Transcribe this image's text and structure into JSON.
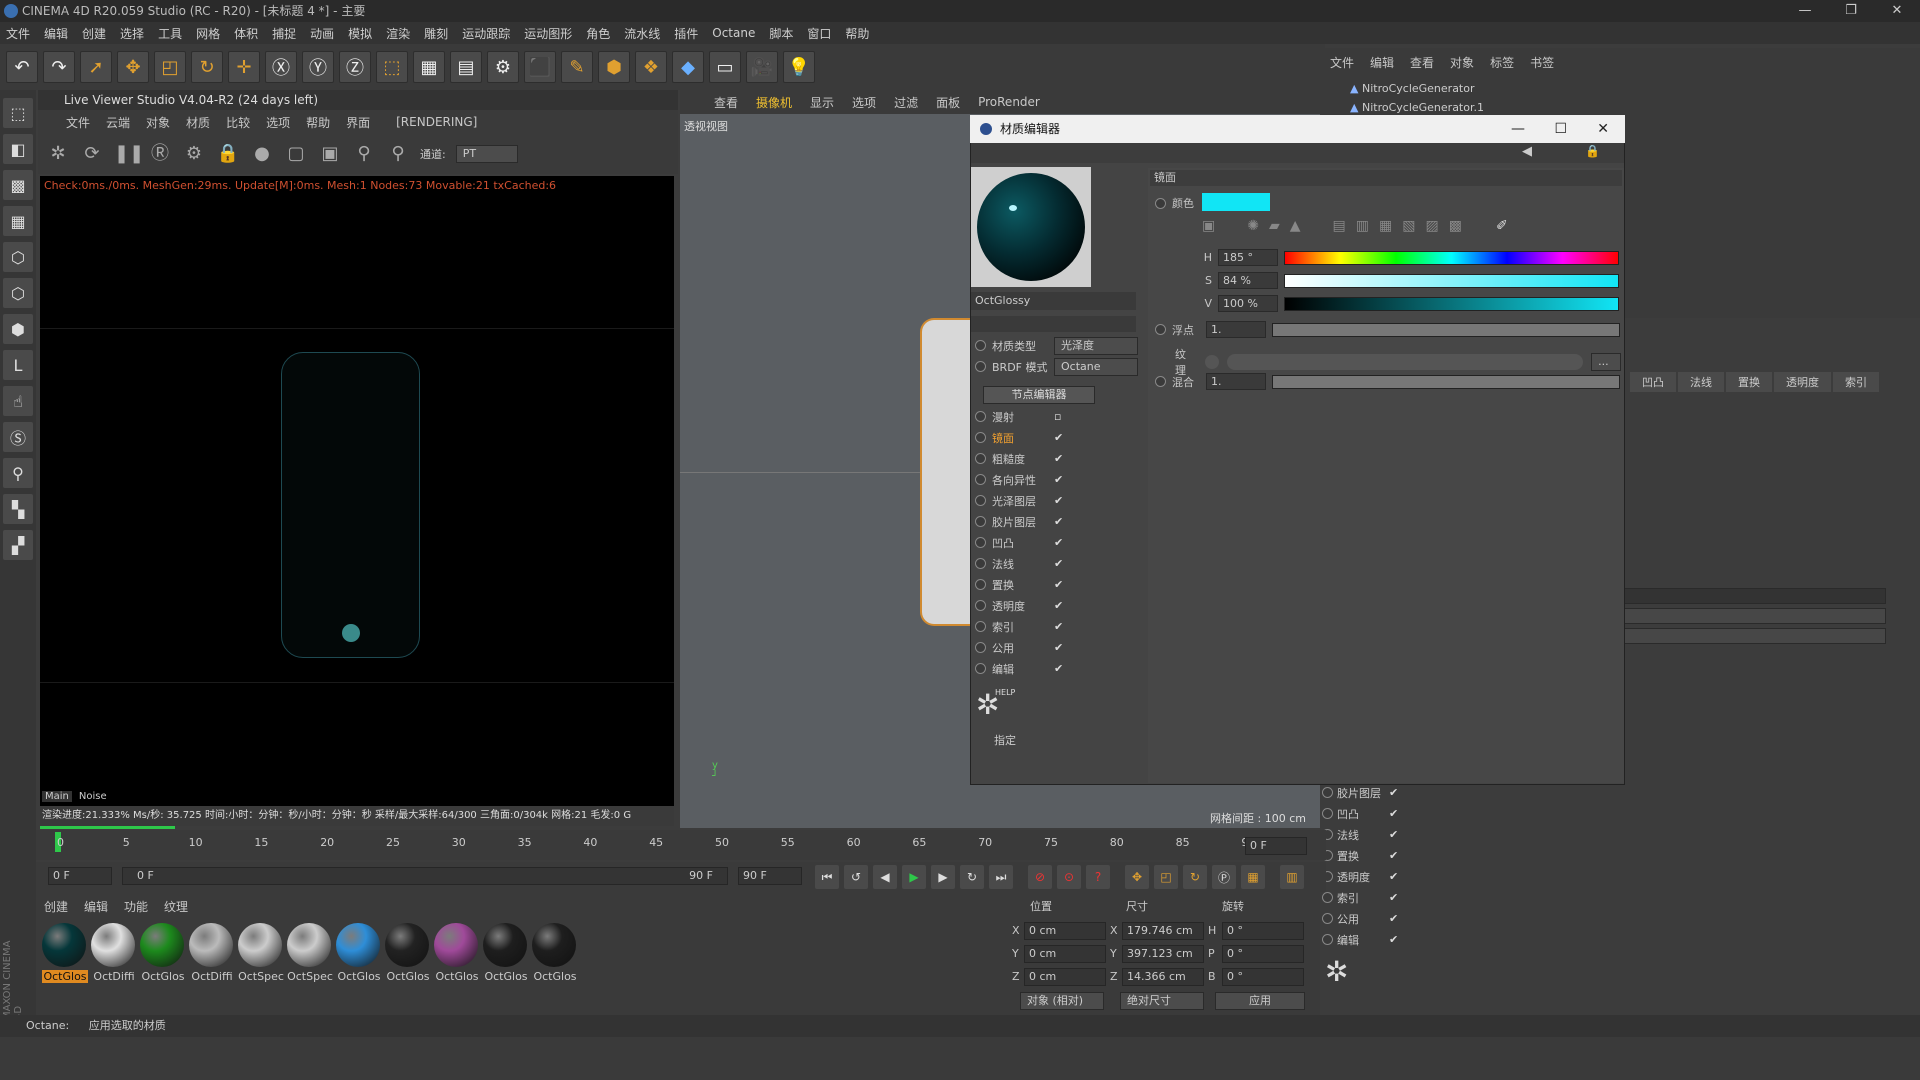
{
  "window": {
    "title": "CINEMA 4D R20.059 Studio (RC - R20) - [未标题 4 *] - 主要"
  },
  "menubar": [
    "文件",
    "编辑",
    "创建",
    "选择",
    "工具",
    "网格",
    "体积",
    "捕捉",
    "动画",
    "模拟",
    "渲染",
    "雕刻",
    "运动跟踪",
    "运动图形",
    "角色",
    "流水线",
    "插件",
    "Octane",
    "脚本",
    "窗口",
    "帮助"
  ],
  "live_viewer": {
    "title": "Live Viewer Studio V4.04-R2 (24 days left)",
    "menu": [
      "文件",
      "云端",
      "对象",
      "材质",
      "比较",
      "选项",
      "帮助",
      "界面"
    ],
    "status_tag": "[RENDERING]",
    "channel_label": "通道:",
    "channel_value": "PT",
    "stats": "Check:0ms./0ms. MeshGen:29ms. Update[M]:0ms. Mesh:1 Nodes:73 Movable:21 txCached:6",
    "tabs": [
      "Main",
      "Noise"
    ],
    "bottom_stats": "渲染进度:21.333%    Ms/秒: 35.725    时间:小时：分钟：秒/小时：分钟：秒    采样/最大采样:64/300    三角面:0/304k    网格:21    毛发:0    G",
    "progress_percent": 21.333
  },
  "viewport": {
    "menu": [
      "查看",
      "摄像机",
      "显示",
      "选项",
      "过滤",
      "面板",
      "ProRender"
    ],
    "label": "透视视图",
    "grid_info": "网格间距 : 100 cm"
  },
  "object_manager": {
    "menu": [
      "文件",
      "编辑",
      "查看",
      "对象",
      "标签",
      "书签"
    ],
    "objects": [
      "NitroCycleGenerator",
      "NitroCycleGenerator.1"
    ]
  },
  "attr_tabs": [
    "凹凸",
    "法线",
    "置换",
    "透明度",
    "索引"
  ],
  "attr_channels": [
    {
      "label": "胶片图层",
      "checked": true
    },
    {
      "label": "凹凸",
      "checked": true
    },
    {
      "label": "法线",
      "checked": true
    },
    {
      "label": "置换",
      "checked": true
    },
    {
      "label": "透明度",
      "checked": true
    },
    {
      "label": "索引",
      "checked": true
    },
    {
      "label": "公用",
      "checked": true
    },
    {
      "label": "编辑",
      "checked": true
    }
  ],
  "material_editor": {
    "title": "材质编辑器",
    "material_name": "OctGlossy",
    "material_type_label": "材质类型",
    "material_type_value": "光泽度",
    "brdf_label": "BRDF 模式",
    "brdf_value": "Octane",
    "node_editor_button": "节点编辑器",
    "channels": [
      {
        "label": "漫射",
        "checked": false,
        "active": false
      },
      {
        "label": "镜面",
        "checked": true,
        "active": true
      },
      {
        "label": "粗糙度",
        "checked": true,
        "active": false
      },
      {
        "label": "各向异性",
        "checked": true,
        "active": false
      },
      {
        "label": "光泽图层",
        "checked": true,
        "active": false
      },
      {
        "label": "胶片图层",
        "checked": true,
        "active": false
      },
      {
        "label": "凹凸",
        "checked": true,
        "active": false
      },
      {
        "label": "法线",
        "checked": true,
        "active": false
      },
      {
        "label": "置换",
        "checked": true,
        "active": false
      },
      {
        "label": "透明度",
        "checked": true,
        "active": false
      },
      {
        "label": "索引",
        "checked": true,
        "active": false
      },
      {
        "label": "公用",
        "checked": true,
        "active": false
      },
      {
        "label": "编辑",
        "checked": true,
        "active": false
      }
    ],
    "help_label": "HELP",
    "assign_label": "指定",
    "section_title": "镜面",
    "color_label": "颜色",
    "color_hex": "#11e5f5",
    "h_label": "H",
    "h_value": "185 °",
    "s_label": "S",
    "s_value": "84 %",
    "v_label": "V",
    "v_value": "100 %",
    "float_label": "浮点",
    "float_value": "1.",
    "texture_label": "纹理",
    "texture_btn": "...",
    "mix_label": "混合",
    "mix_value": "1."
  },
  "timeline": {
    "ticks": [
      "0",
      "5",
      "10",
      "15",
      "20",
      "25",
      "30",
      "35",
      "40",
      "45",
      "50",
      "55",
      "60",
      "65",
      "70",
      "75",
      "80",
      "85",
      "90"
    ],
    "current_frame": "0 F",
    "start_field": "0 F",
    "range_left": "0 F",
    "range_right": "90 F",
    "end_field": "90 F"
  },
  "material_bar": {
    "tabs": [
      "创建",
      "编辑",
      "功能",
      "纹理"
    ],
    "items": [
      {
        "label": "OctGlos",
        "color": "#05373a"
      },
      {
        "label": "OctDiffi",
        "color": "#e0e0e0"
      },
      {
        "label": "OctGlos",
        "color": "#1d8a1d"
      },
      {
        "label": "OctDiffi",
        "color": "#bbbbbb"
      },
      {
        "label": "OctSpec",
        "color": "#cccccc"
      },
      {
        "label": "OctSpec",
        "color": "#cccccc"
      },
      {
        "label": "OctGlos",
        "color": "#2e8ed8"
      },
      {
        "label": "OctGlos",
        "color": "#222222"
      },
      {
        "label": "OctGlos",
        "color": "#a04a9a"
      },
      {
        "label": "OctGlos",
        "color": "#1e1e1e"
      },
      {
        "label": "OctGlos",
        "color": "#1e1e1e"
      }
    ]
  },
  "coords": {
    "headers": [
      "位置",
      "尺寸",
      "旋转"
    ],
    "rows": [
      {
        "axis": "X",
        "pos": "0 cm",
        "size_axis": "X",
        "size": "179.746 cm",
        "rot_axis": "H",
        "rot": "0 °"
      },
      {
        "axis": "Y",
        "pos": "0 cm",
        "size_axis": "Y",
        "size": "397.123 cm",
        "rot_axis": "P",
        "rot": "0 °"
      },
      {
        "axis": "Z",
        "pos": "0 cm",
        "size_axis": "Z",
        "size": "14.366 cm",
        "rot_axis": "B",
        "rot": "0 °"
      }
    ],
    "mode1": "对象 (相对)",
    "mode2": "绝对尺寸",
    "apply": "应用"
  },
  "statusbar": {
    "left": "Octane:",
    "message": "应用选取的材质"
  },
  "branding": "MAXON CINEMA 4D"
}
